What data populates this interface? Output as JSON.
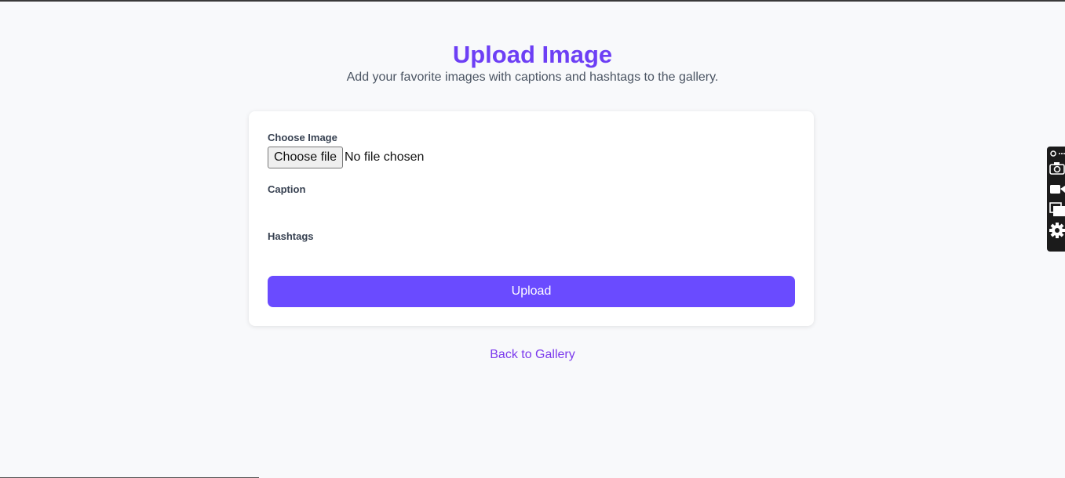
{
  "header": {
    "title": "Upload Image",
    "subtitle": "Add your favorite images with captions and hashtags to the gallery."
  },
  "form": {
    "image_label": "Choose Image",
    "file_button_label": "Choose file",
    "file_status": "No file chosen",
    "caption_label": "Caption",
    "caption_value": "",
    "hashtags_label": "Hashtags",
    "hashtags_value": "",
    "submit_label": "Upload"
  },
  "footer": {
    "back_link": "Back to Gallery"
  },
  "side_toolbar": {
    "icons": [
      "link-icon",
      "camera-icon",
      "video-icon",
      "window-icon",
      "gear-icon"
    ]
  },
  "colors": {
    "accent": "#6d3ff5",
    "button": "#6a4bff",
    "link": "#7c3aed",
    "background": "#f8f9fb"
  }
}
